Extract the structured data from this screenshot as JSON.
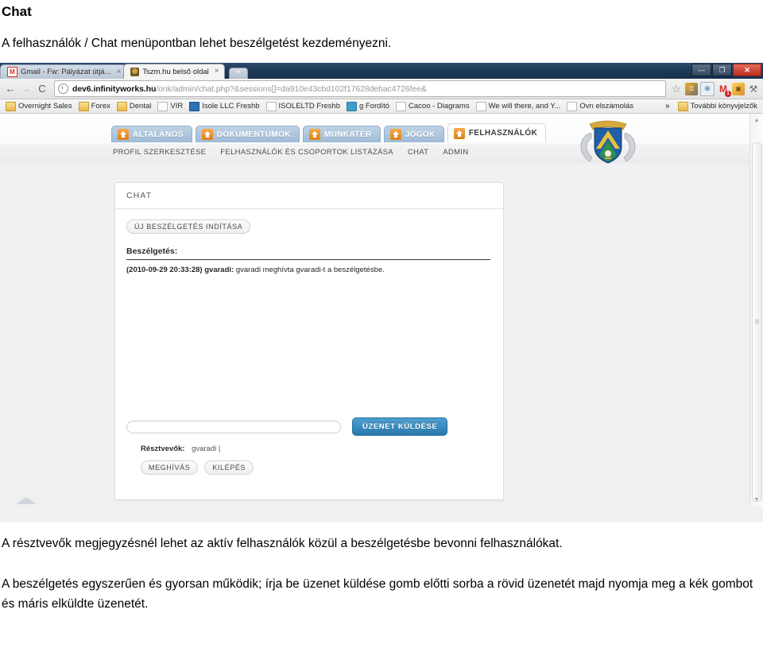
{
  "document": {
    "title": "Chat",
    "intro": "A felhasználók / Chat menüpontban lehet beszélgetést kezdeményezni.",
    "para1": "A résztvevők megjegyzésnél lehet az aktív felhasználók közül a beszélgetésbe bevonni felhasználókat.",
    "para2": "A beszélgetés egyszerűen és gyorsan működik; írja be üzenet küldése gomb előtti sorba a rövid üzenetét majd nyomja meg a kék gombot és máris elküldte üzenetét."
  },
  "browser": {
    "tabs": [
      {
        "label": "Gmail - Fw: Pályázat útjá...",
        "favicon": "gmail-icon",
        "active": false,
        "close": "×"
      },
      {
        "label": "Tszm.hu belső oldal",
        "favicon": "crest-icon",
        "active": true,
        "close": "×"
      }
    ],
    "new_tab_label": "+",
    "window_controls": {
      "minimize": "—",
      "maximize": "❐",
      "close": "✕"
    },
    "nav": {
      "back": "←",
      "forward": "→",
      "reload": "C"
    },
    "omnibox": {
      "url_host": "dev6.infinityworks.hu",
      "url_path": "/onk/admin/chat.php?&sessions[]=da910e43cbd102f17628debac4726fee&"
    },
    "toolbar_icons": [
      {
        "name": "bookmark-star-icon",
        "glyph": "☆"
      },
      {
        "name": "lastpass-icon",
        "glyph": "⚿"
      },
      {
        "name": "globe-extension-icon",
        "glyph": "⊕"
      },
      {
        "name": "gmail-checker-icon",
        "glyph": "M",
        "badge": "1"
      },
      {
        "name": "extension-icon",
        "glyph": "▣"
      },
      {
        "name": "wrench-menu-icon",
        "glyph": "⚒"
      }
    ],
    "bookmarks": [
      {
        "label": "Overnight Sales",
        "icon": "folder-icon"
      },
      {
        "label": "Forex",
        "icon": "folder-icon"
      },
      {
        "label": "Dental",
        "icon": "folder-icon"
      },
      {
        "label": "VIR",
        "icon": "page-icon"
      },
      {
        "label": "Isole LLC Freshb",
        "icon": "blue-app-icon"
      },
      {
        "label": "ISOLELTD Freshb",
        "icon": "page-icon"
      },
      {
        "label": "g Fordító",
        "icon": "translate-icon"
      },
      {
        "label": "Cacoo - Diagrams",
        "icon": "page-icon"
      },
      {
        "label": "We will there, and Y...",
        "icon": "page-icon"
      },
      {
        "label": "Ovn elszámolás",
        "icon": "page-icon"
      }
    ],
    "bookmarks_overflow": "»",
    "bookmarks_more": {
      "label": "További könyvjelzők",
      "icon": "folder-icon"
    }
  },
  "app": {
    "main_tabs": [
      {
        "label": "ÁLTALÁNOS",
        "active": false
      },
      {
        "label": "DOKUMENTUMOK",
        "active": false
      },
      {
        "label": "MUNKATÉR",
        "active": false
      },
      {
        "label": "JOGOK",
        "active": false
      },
      {
        "label": "FELHASZNÁLÓK",
        "active": true
      }
    ],
    "sub_nav": [
      "PROFIL SZERKESZTÉSE",
      "FELHASZNÁLÓK ÉS CSOPORTOK LISTÁZÁSA",
      "CHAT",
      "ADMIN"
    ],
    "panel": {
      "heading": "CHAT",
      "new_conversation_button": "ÚJ BESZÉLGETÉS INDÍTÁSA",
      "conversation_label": "Beszélgetés:",
      "messages": [
        {
          "timestamp": "(2010-09-29 20:33:28)",
          "author": "gvaradi:",
          "text": "gvaradi meghívta gvaradi-t a beszélgetésbe."
        }
      ],
      "message_input_value": "",
      "message_input_placeholder": "",
      "send_button": "ÜZENET KÜLDÉSE",
      "participants_label": "Résztvevők:",
      "participants_value": "gvaradi |",
      "invite_button": "MEGHÍVÁS",
      "leave_button": "KILÉPÉS"
    },
    "crest_alt": "coat-of-arms"
  },
  "colors": {
    "accent_blue": "#2778ac",
    "tab_blue": "#9fbcd6",
    "house_orange": "#e07f16",
    "titlebar": "#1f3a59"
  }
}
